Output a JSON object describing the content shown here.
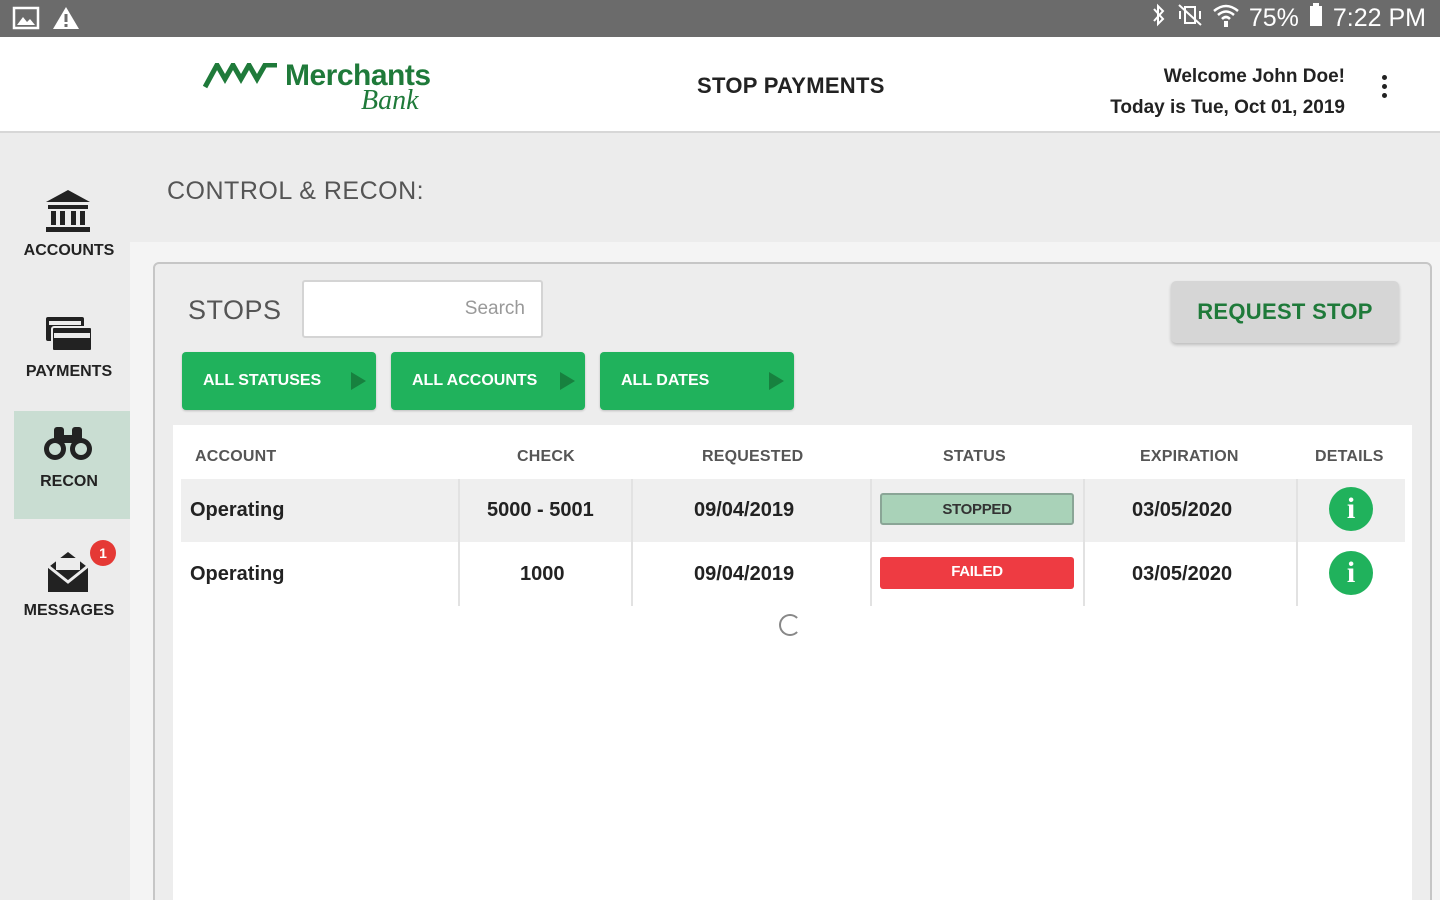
{
  "status_bar": {
    "battery": "75%",
    "time": "7:22 PM"
  },
  "header": {
    "logo_title": "Merchants",
    "logo_subtitle": "Bank",
    "page_title": "STOP PAYMENTS",
    "welcome": "Welcome John Doe!",
    "date_line": "Today is Tue, Oct 01, 2019"
  },
  "sidebar": {
    "items": [
      {
        "label": "ACCOUNTS",
        "icon": "bank-icon"
      },
      {
        "label": "PAYMENTS",
        "icon": "cards-icon"
      },
      {
        "label": "RECON",
        "icon": "binoculars-icon",
        "active": true
      },
      {
        "label": "MESSAGES",
        "icon": "envelope-icon",
        "badge": "1"
      }
    ]
  },
  "section": {
    "title": "CONTROL & RECON:"
  },
  "stops": {
    "label": "STOPS",
    "search_placeholder": "Search",
    "request_button": "REQUEST STOP",
    "filters": [
      "ALL STATUSES",
      "ALL ACCOUNTS",
      "ALL DATES"
    ]
  },
  "table": {
    "columns": [
      "ACCOUNT",
      "CHECK",
      "REQUESTED",
      "STATUS",
      "EXPIRATION",
      "DETAILS"
    ],
    "rows": [
      {
        "account": "Operating",
        "check": "5000 - 5001",
        "requested": "09/04/2019",
        "status": "STOPPED",
        "expiration": "03/05/2020",
        "details": "i"
      },
      {
        "account": "Operating",
        "check": "1000",
        "requested": "09/04/2019",
        "status": "FAILED",
        "expiration": "03/05/2020",
        "details": "i"
      }
    ]
  },
  "colors": {
    "brand_green": "#1f7a3a",
    "button_green": "#20b25c",
    "stopped": "#a9d2b8",
    "failed": "#ee3b42"
  }
}
